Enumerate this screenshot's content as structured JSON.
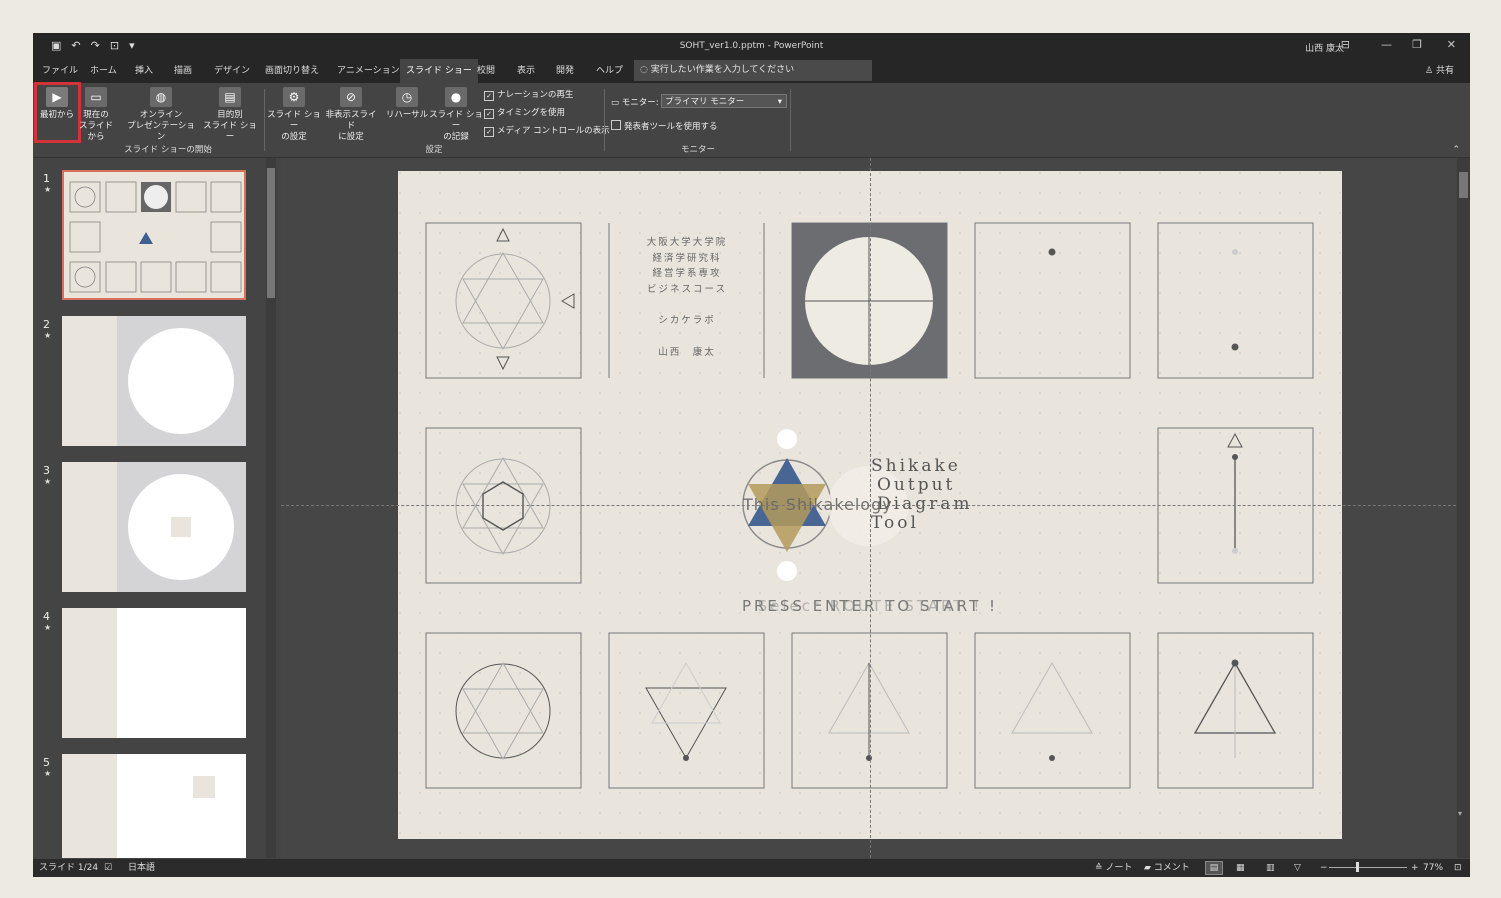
{
  "window": {
    "title": "SOHT_ver1.0.pptm - PowerPoint",
    "user": "山西 康太"
  },
  "tabs": [
    "ファイル",
    "ホーム",
    "挿入",
    "描画",
    "デザイン",
    "画面切り替え",
    "アニメーション",
    "スライド ショー",
    "校閲",
    "表示",
    "開発",
    "ヘルプ"
  ],
  "tell_me": "実行したい作業を入力してください",
  "share": "共有",
  "ribbon": {
    "from_start": "最初から",
    "from_current": [
      "現在の",
      "スライドから"
    ],
    "online": [
      "オンライン",
      "プレゼンテーション"
    ],
    "custom": [
      "目的別",
      "スライド ショー"
    ],
    "group_start": "スライド ショーの開始",
    "setup_show": [
      "スライド ショー",
      "の設定"
    ],
    "hide_slide": [
      "非表示スライド",
      "に設定"
    ],
    "rehearse": "リハーサル",
    "record": [
      "スライド ショー",
      "の記録"
    ],
    "play_narrations": "ナレーションの再生",
    "use_timings": "タイミングを使用",
    "show_media": "メディア コントロールの表示",
    "group_setup": "設定",
    "monitor_label": "モニター:",
    "monitor_value": "プライマリ モニター",
    "presenter_view": "発表者ツールを使用する",
    "group_monitor": "モニター"
  },
  "thumbnails": [
    {
      "num": "1"
    },
    {
      "num": "2"
    },
    {
      "num": "3"
    },
    {
      "num": "4"
    },
    {
      "num": "5"
    }
  ],
  "slide": {
    "title_lines": [
      "大阪大学大学院",
      "経済学研究科",
      "経営学系専攻",
      "ビジネスコース",
      "シカケラボ",
      "山西　康太"
    ],
    "logo_text": [
      "Shikake",
      "Output",
      "Diagram",
      "Tool"
    ],
    "logo_text2": "This Shikakelogy",
    "prompt": "PRESS ENTER TO START !",
    "prompt2": "Select ROUTE START !"
  },
  "status": {
    "slide": "スライド 1/24",
    "lang": "日本語",
    "notes": "ノート",
    "comments": "コメント",
    "zoom": "77%"
  }
}
